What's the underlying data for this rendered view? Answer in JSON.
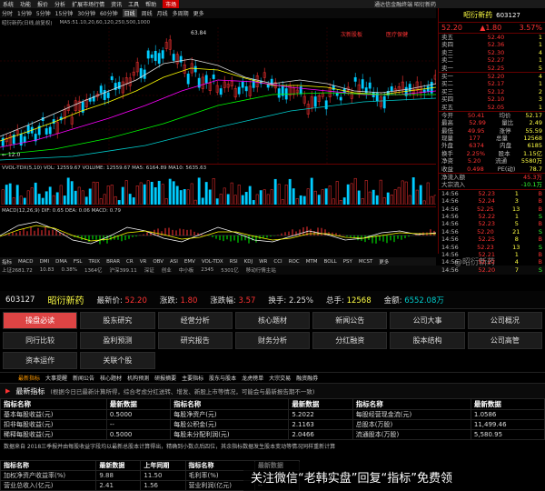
{
  "menubar": {
    "items": [
      "系统",
      "功能",
      "报价",
      "分析",
      "扩展市场行情",
      "资讯",
      "工具",
      "帮助"
    ],
    "highlight": "市场",
    "center_title": "通达信金融终端 昭衍新药"
  },
  "timeframes": {
    "items": [
      "分时",
      "1分钟",
      "5分钟",
      "15分钟",
      "30分钟",
      "60分钟",
      "日线",
      "周线",
      "月线",
      "多周期",
      "更多"
    ],
    "selected": "日线"
  },
  "chart_info": {
    "title": "昭衍新药(日线,前复权)",
    "ma": "MA5:51.10,20,60,120,250,500,1000",
    "labels": [
      "L1",
      "MA1",
      "MA2",
      "MA3",
      "MA4",
      "MA5"
    ]
  },
  "annotations": {
    "peak": "63.84",
    "low_label": "← 12.0",
    "tag1": "次新股板",
    "tag2": "医疗保健"
  },
  "vol_info": "VVOL-TDX(5,10) VOL: 12559.67  VOLUME: 12559.67  MA5: 6164.89  MA10: 5635.63",
  "macd_info": "MACD(12,26,9)  DIF: 0.65  DEA: 0.06  MACD: 0.79",
  "bottom_tabs": [
    "指标",
    "MACD",
    "DMI",
    "DMA",
    "FSL",
    "TRIX",
    "BRAR",
    "CR",
    "VR",
    "OBV",
    "ASI",
    "EMV",
    "VOL-TDX",
    "RSI",
    "KDJ",
    "WR",
    "CCI",
    "ROC",
    "MTM",
    "BOLL",
    "PSY",
    "MCST",
    "更多"
  ],
  "status": [
    "上证2681.72",
    "10.83",
    "0.38%",
    "1364亿",
    "沪深399.11",
    "深证",
    "创业",
    "中小板",
    "2345",
    "5301亿",
    "移动行情主站"
  ],
  "watermark": "@昭衍新药",
  "quote_panel": {
    "name": "昭衍新药",
    "code": "603127",
    "price": "52.20",
    "change": "▲1.80",
    "pct": "3.57%",
    "sells": [
      {
        "label": "卖五",
        "price": "52.40",
        "vol": "1"
      },
      {
        "label": "卖四",
        "price": "52.36",
        "vol": "1"
      },
      {
        "label": "卖三",
        "price": "52.30",
        "vol": "4"
      },
      {
        "label": "卖二",
        "price": "52.27",
        "vol": "1"
      },
      {
        "label": "卖一",
        "price": "52.25",
        "vol": "5"
      }
    ],
    "buys": [
      {
        "label": "买一",
        "price": "52.20",
        "vol": "4"
      },
      {
        "label": "买二",
        "price": "52.17",
        "vol": "1"
      },
      {
        "label": "买三",
        "price": "52.12",
        "vol": "2"
      },
      {
        "label": "买四",
        "price": "52.10",
        "vol": "3"
      },
      {
        "label": "买五",
        "price": "52.05",
        "vol": "1"
      }
    ],
    "stats": [
      {
        "l1": "今开",
        "v1": "50.41",
        "l2": "均价",
        "v2": "52.17"
      },
      {
        "l1": "最高",
        "v1": "52.99",
        "l2": "量比",
        "v2": "2.49"
      },
      {
        "l1": "最低",
        "v1": "49.95",
        "l2": "涨停",
        "v2": "55.59"
      },
      {
        "l1": "现量",
        "v1": "177",
        "l2": "总量",
        "v2": "12568"
      },
      {
        "l1": "外盘",
        "v1": "6374",
        "l2": "内盘",
        "v2": "6185"
      },
      {
        "l1": "换手",
        "v1": "2.25%",
        "l2": "股本",
        "v2": "1.15亿"
      },
      {
        "l1": "净资",
        "v1": "5.20",
        "l2": "流通",
        "v2": "5580万"
      },
      {
        "l1": "收益",
        "v1": "0.498",
        "l2": "PE(动)",
        "v2": "78.7"
      }
    ],
    "flows": [
      {
        "l": "净流入额",
        "v": "45.3万"
      },
      {
        "l": "大宗流入",
        "v": "-10.1万"
      }
    ],
    "ticks": [
      {
        "t": "14:56",
        "p": "52.23",
        "v": "1",
        "d": "B"
      },
      {
        "t": "14:56",
        "p": "52.24",
        "v": "3",
        "d": "B"
      },
      {
        "t": "14:56",
        "p": "52.25",
        "v": "13",
        "d": "B"
      },
      {
        "t": "14:56",
        "p": "52.22",
        "v": "1",
        "d": "S"
      },
      {
        "t": "14:56",
        "p": "52.23",
        "v": "5",
        "d": "B"
      },
      {
        "t": "14:56",
        "p": "52.20",
        "v": "21",
        "d": "S"
      },
      {
        "t": "14:56",
        "p": "52.25",
        "v": "8",
        "d": "B"
      },
      {
        "t": "14:56",
        "p": "52.23",
        "v": "13",
        "d": "S"
      },
      {
        "t": "14:56",
        "p": "52.21",
        "v": "1",
        "d": "B"
      },
      {
        "t": "14:56",
        "p": "52.22",
        "v": "4",
        "d": "B"
      },
      {
        "t": "14:56",
        "p": "52.20",
        "v": "7",
        "d": "S"
      }
    ]
  },
  "summary": {
    "code": "603127",
    "name": "昭衍新药",
    "price_label": "最新价:",
    "price": "52.20",
    "chg_label": "涨跌:",
    "chg": "1.80",
    "pct_label": "涨跌幅:",
    "pct": "3.57",
    "turn_label": "换手:",
    "turn": "2.25%",
    "cap_label": "总手:",
    "cap": "12568",
    "amt_label": "金额:",
    "amt": "6552.08万"
  },
  "nav": [
    "操盘必读",
    "股东研究",
    "经营分析",
    "核心题材",
    "新闻公告",
    "公司大事",
    "公司概况",
    "同行比较",
    "盈利预测",
    "研究报告",
    "财务分析",
    "分红融资",
    "股本结构",
    "公司高管",
    "资本运作",
    "关联个股"
  ],
  "nav_active": "操盘必读",
  "sublinks": [
    "最新指标",
    "大事提醒",
    "新闻公告",
    "核心题材",
    "机构预测",
    "研报摘要",
    "主要指标",
    "股东与股本",
    "龙虎榜单",
    "大宗交易",
    "融资融券"
  ],
  "section": {
    "title": "最新指标",
    "note": "(根据今日已最新计算所得，综合考虑分红送转、增发、新股上市等情况，可能会与最新报告期不一致)"
  },
  "table1": {
    "headers": [
      "指标名称",
      "最新数据",
      "指标名称",
      "最新数据",
      "指标名称",
      "最新数据"
    ],
    "rows": [
      [
        "基本每股收益(元)",
        "0.5000",
        "每股净资产(元)",
        "5.2022",
        "每股经营现金流(元)",
        "1.0586"
      ],
      [
        "扣非每股收益(元)",
        "--",
        "每股公积金(元)",
        "2.1163",
        "总股本(万股)",
        "11,499.46"
      ],
      [
        "稀释每股收益(元)",
        "0.5000",
        "每股未分配利润(元)",
        "2.0466",
        "流通股本(万股)",
        "5,580.95"
      ]
    ]
  },
  "footnote": "数据来自 2018三季报并由每股收益字段均以最新总股本计算得出，精确到小数点后四位，其余指标数据发生股本变动等情况同样重新计算",
  "table2": {
    "headers": [
      "指标名称",
      "最新数据",
      "上年同期",
      "指标名称",
      "最新数据"
    ],
    "rows": [
      [
        "加权净资产收益率(%)",
        "9.88",
        "11.50",
        "毛利率(%)",
        "--"
      ],
      [
        "营业总收入(亿元)",
        "2.41",
        "1.56",
        "营业利润(亿元)",
        "--"
      ]
    ]
  },
  "overlay": "关注微信“老韩实盘”回复“指标”免费领"
}
